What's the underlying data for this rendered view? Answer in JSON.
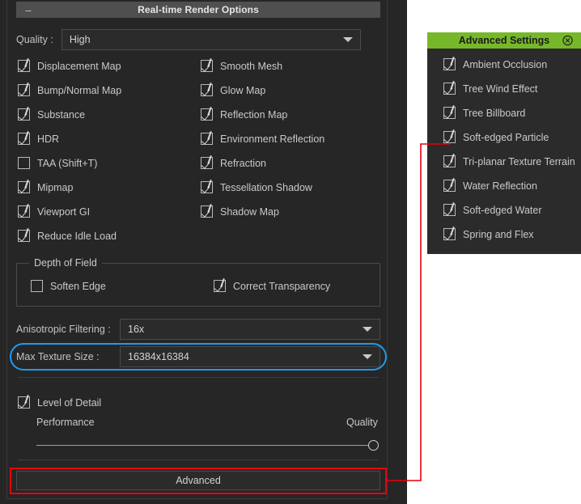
{
  "window": {
    "title": "Real-time Render Options",
    "collapse_icon": "minus-icon"
  },
  "quality": {
    "label": "Quality :",
    "value": "High",
    "dropdown_icon": "chevron-down-icon"
  },
  "render_options": [
    {
      "label": "Displacement Map",
      "checked": true
    },
    {
      "label": "Smooth Mesh",
      "checked": true
    },
    {
      "label": "Bump/Normal Map",
      "checked": true
    },
    {
      "label": "Glow Map",
      "checked": true
    },
    {
      "label": "Substance",
      "checked": true
    },
    {
      "label": "Reflection Map",
      "checked": true
    },
    {
      "label": "HDR",
      "checked": true
    },
    {
      "label": "Environment Reflection",
      "checked": true
    },
    {
      "label": "TAA (Shift+T)",
      "checked": false
    },
    {
      "label": "Refraction",
      "checked": true
    },
    {
      "label": "Mipmap",
      "checked": true
    },
    {
      "label": "Tessellation Shadow",
      "checked": true
    },
    {
      "label": "Viewport GI",
      "checked": true
    },
    {
      "label": "Shadow Map",
      "checked": true
    },
    {
      "label": "Reduce Idle Load",
      "checked": true
    }
  ],
  "depth_of_field": {
    "legend": "Depth of Field",
    "items": [
      {
        "label": "Soften Edge",
        "checked": false
      },
      {
        "label": "Correct Transparency",
        "checked": true
      }
    ]
  },
  "anisotropic": {
    "label": "Anisotropic Filtering :",
    "value": "16x",
    "dropdown_icon": "chevron-down-icon"
  },
  "max_texture": {
    "label": "Max Texture Size :",
    "value": "16384x16384",
    "dropdown_icon": "chevron-down-icon",
    "highlight_color": "#1e9bf0"
  },
  "level_of_detail": {
    "label": "Level of Detail",
    "checked": true,
    "slider_min_label": "Performance",
    "slider_max_label": "Quality",
    "slider_value": 100
  },
  "advanced_button": {
    "label": "Advanced",
    "annotation_color": "#e8000b"
  },
  "advanced_panel": {
    "title": "Advanced Settings",
    "header_color": "#76b82a",
    "close_icon": "close-circle-icon",
    "items": [
      {
        "label": "Ambient Occlusion",
        "checked": true
      },
      {
        "label": "Tree Wind Effect",
        "checked": true
      },
      {
        "label": "Tree Billboard",
        "checked": true
      },
      {
        "label": "Soft-edged Particle",
        "checked": true
      },
      {
        "label": "Tri-planar Texture Terrain",
        "checked": true
      },
      {
        "label": "Water Reflection",
        "checked": true
      },
      {
        "label": "Soft-edged Water",
        "checked": true
      },
      {
        "label": "Spring and Flex",
        "checked": true
      }
    ]
  },
  "scrollbar": {
    "name": "vertical-scrollbar"
  }
}
